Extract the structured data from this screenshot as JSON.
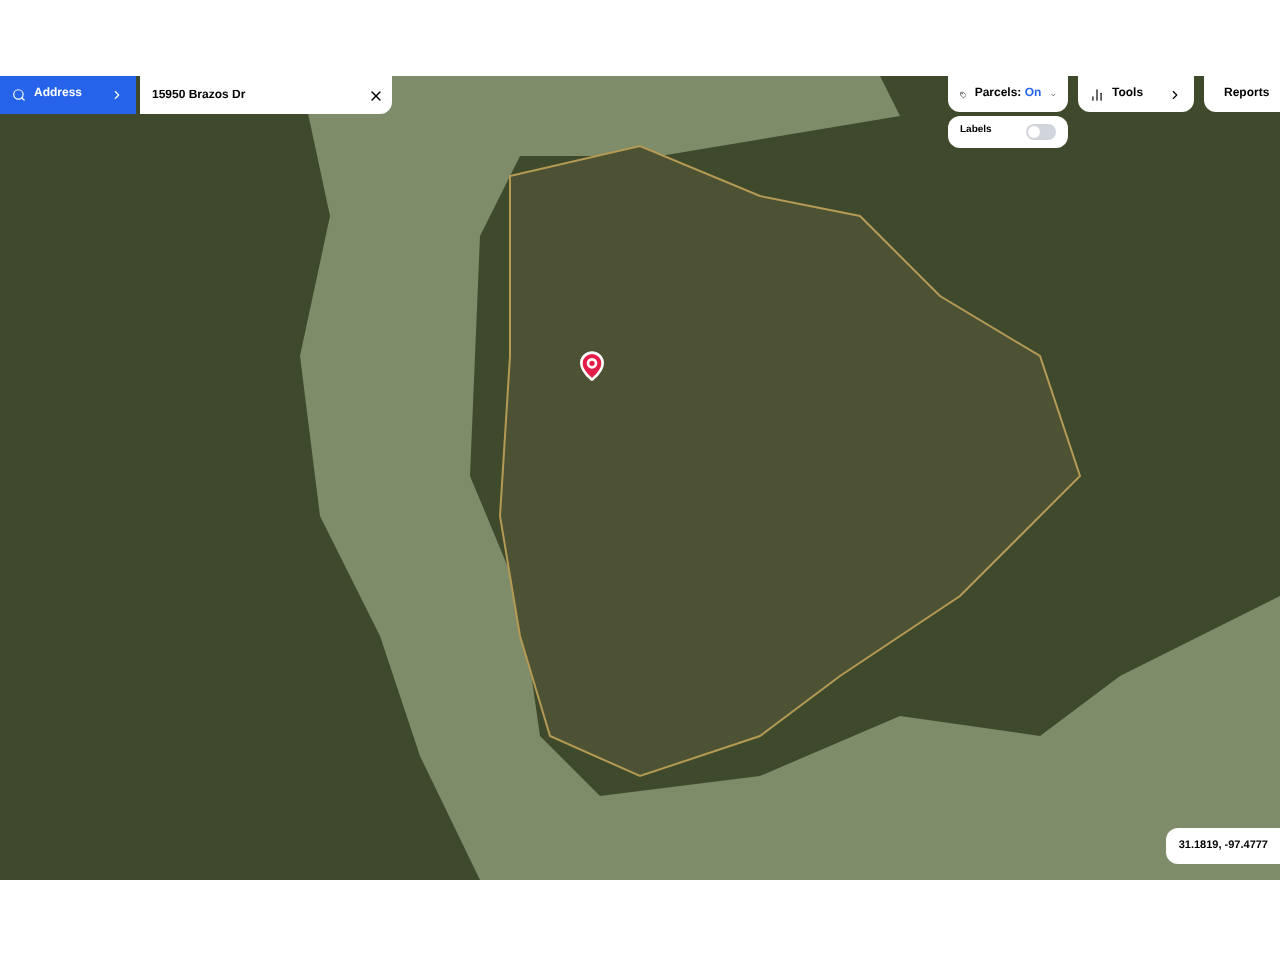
{
  "address_button": {
    "label": "Address"
  },
  "search": {
    "value": "15950 Brazos Dr"
  },
  "parcels": {
    "label": "Parcels:",
    "state": "On"
  },
  "tools": {
    "label": "Tools"
  },
  "reports": {
    "label": "Reports"
  },
  "labels_toggle": {
    "label": "Labels",
    "on": false
  },
  "coordinates": "31.1819, -97.4777"
}
